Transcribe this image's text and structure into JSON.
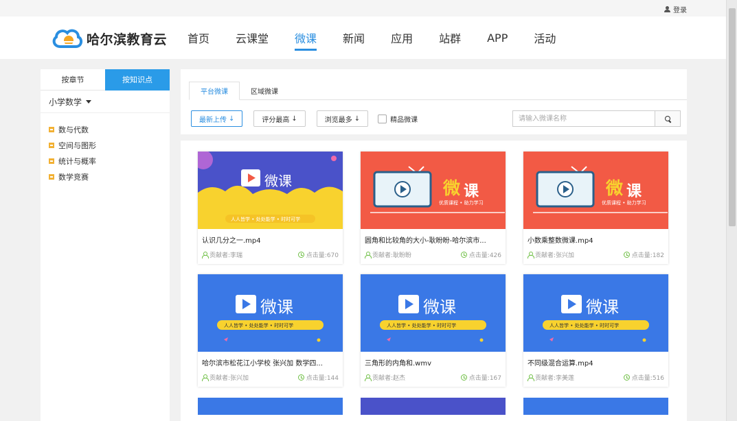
{
  "topbar": {
    "login_label": "登录"
  },
  "brand": {
    "name": "哈尔滨教育云"
  },
  "nav": [
    {
      "label": "首页"
    },
    {
      "label": "云课堂"
    },
    {
      "label": "微课"
    },
    {
      "label": "新闻"
    },
    {
      "label": "应用"
    },
    {
      "label": "站群"
    },
    {
      "label": "APP"
    },
    {
      "label": "活动"
    }
  ],
  "sidebar": {
    "tabs": [
      {
        "label": "按章节"
      },
      {
        "label": "按知识点"
      }
    ],
    "subject": "小学数学",
    "categories": [
      {
        "label": "数与代数"
      },
      {
        "label": "空间与图形"
      },
      {
        "label": "统计与概率"
      },
      {
        "label": "数学竞赛"
      }
    ]
  },
  "main": {
    "tabs": [
      {
        "label": "平台微课"
      },
      {
        "label": "区域微课"
      }
    ],
    "filters": [
      {
        "label": "最新上传"
      },
      {
        "label": "评分最高"
      },
      {
        "label": "浏览最多"
      }
    ],
    "filter_arrow": "↓",
    "checkbox_label": "精品微课",
    "search_placeholder": "请输入微课名称"
  },
  "thumb_text": {
    "weike": "微课",
    "slogan": "人人皆学 • 处处能学 • 时时可学",
    "red_weike_a": "微",
    "red_weike_b": "课",
    "red_sub": "优质课程 • 助力学习"
  },
  "colors": {
    "accent": "#2a8ee0",
    "sidebar_active": "#2a9be8",
    "thumb_blue": "#3a78e6",
    "thumb_red": "#f25a45",
    "thumb_yellow": "#f8d22e",
    "icon_green": "#6fbf45"
  },
  "cards": [
    {
      "title": "认识几分之一.mp4",
      "contributor": "贡献者:李瑞",
      "views": "点击量:670",
      "thumb": "yellow"
    },
    {
      "title": "圆角和比较角的大小-耿盼盼-哈尔滨市...",
      "contributor": "贡献者:耿盼盼",
      "views": "点击量:426",
      "thumb": "red"
    },
    {
      "title": "小数乘整数微课.mp4",
      "contributor": "贡献者:张兴加",
      "views": "点击量:182",
      "thumb": "red"
    },
    {
      "title": "哈尔滨市松花江小学校 张兴加 数学四...",
      "contributor": "贡献者:张兴加",
      "views": "点击量:144",
      "thumb": "blue"
    },
    {
      "title": "三角形的内角和.wmv",
      "contributor": "贡献者:赵杰",
      "views": "点击量:167",
      "thumb": "blue"
    },
    {
      "title": "不同级混合运算.mp4",
      "contributor": "贡献者:李美莲",
      "views": "点击量:516",
      "thumb": "blue"
    }
  ]
}
